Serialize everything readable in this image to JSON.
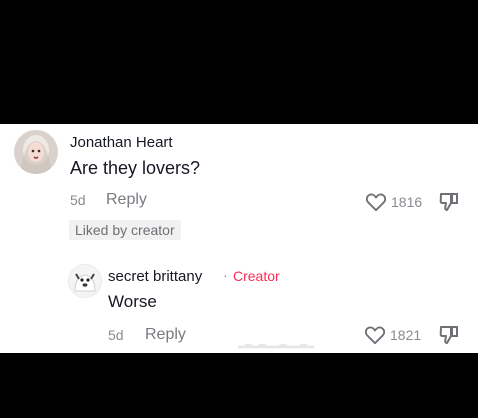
{
  "comment": {
    "username": "Jonathan Heart",
    "text": "Are they lovers?",
    "age": "5d",
    "reply_label": "Reply",
    "like_count": "1816",
    "badge": "Liked by creator"
  },
  "reply": {
    "username": "secret brittany",
    "separator": "·",
    "creator_label": "Creator",
    "text": "Worse",
    "age": "5d",
    "reply_label": "Reply",
    "like_count": "1821"
  },
  "colors": {
    "creator_accent": "#fe2c55",
    "text_primary": "#161823",
    "text_muted": "#8a8b91"
  }
}
